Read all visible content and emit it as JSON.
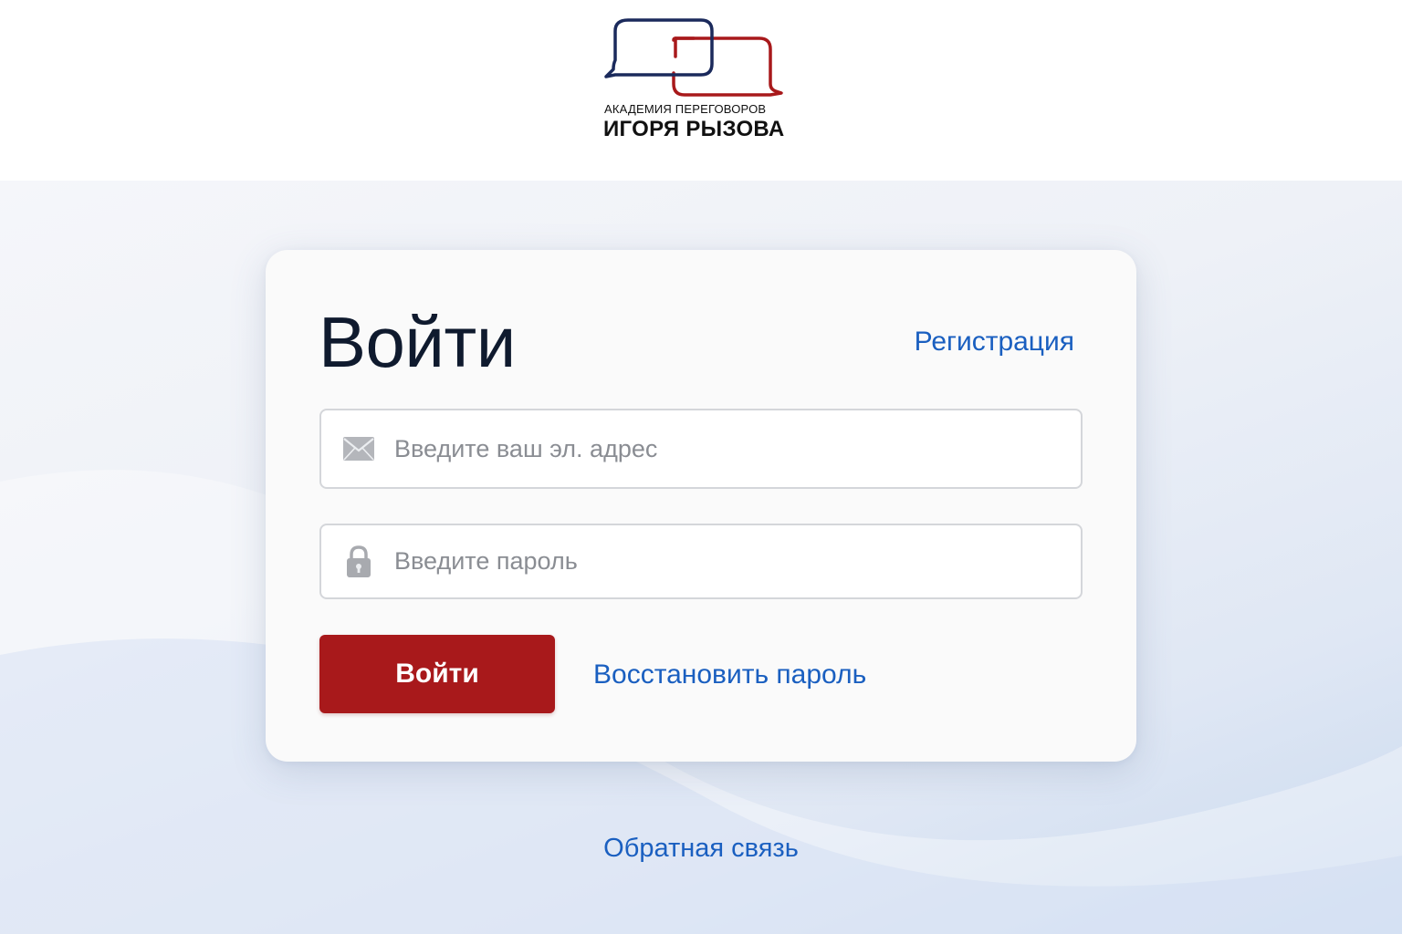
{
  "header": {
    "logo": {
      "line1": "АКАДЕМИЯ ПЕРЕГОВОРОВ",
      "line2": "ИГОРЯ РЫЗОВА",
      "icon": "speech-bubbles-logo-icon",
      "colors": {
        "navy": "#1b2a5c",
        "red": "#a8191b"
      }
    }
  },
  "login_card": {
    "title": "Войти",
    "register_link": "Регистрация",
    "email_field": {
      "icon": "envelope-icon",
      "placeholder": "Введите ваш эл. адрес",
      "value": ""
    },
    "password_field": {
      "icon": "lock-icon",
      "placeholder": "Введите пароль",
      "value": ""
    },
    "submit_label": "Войти",
    "restore_link": "Восстановить пароль"
  },
  "footer": {
    "feedback_link": "Обратная связь"
  },
  "colors": {
    "accent_red": "#a8191b",
    "link_blue": "#1a5fc0",
    "title_dark": "#0f1a2e"
  }
}
